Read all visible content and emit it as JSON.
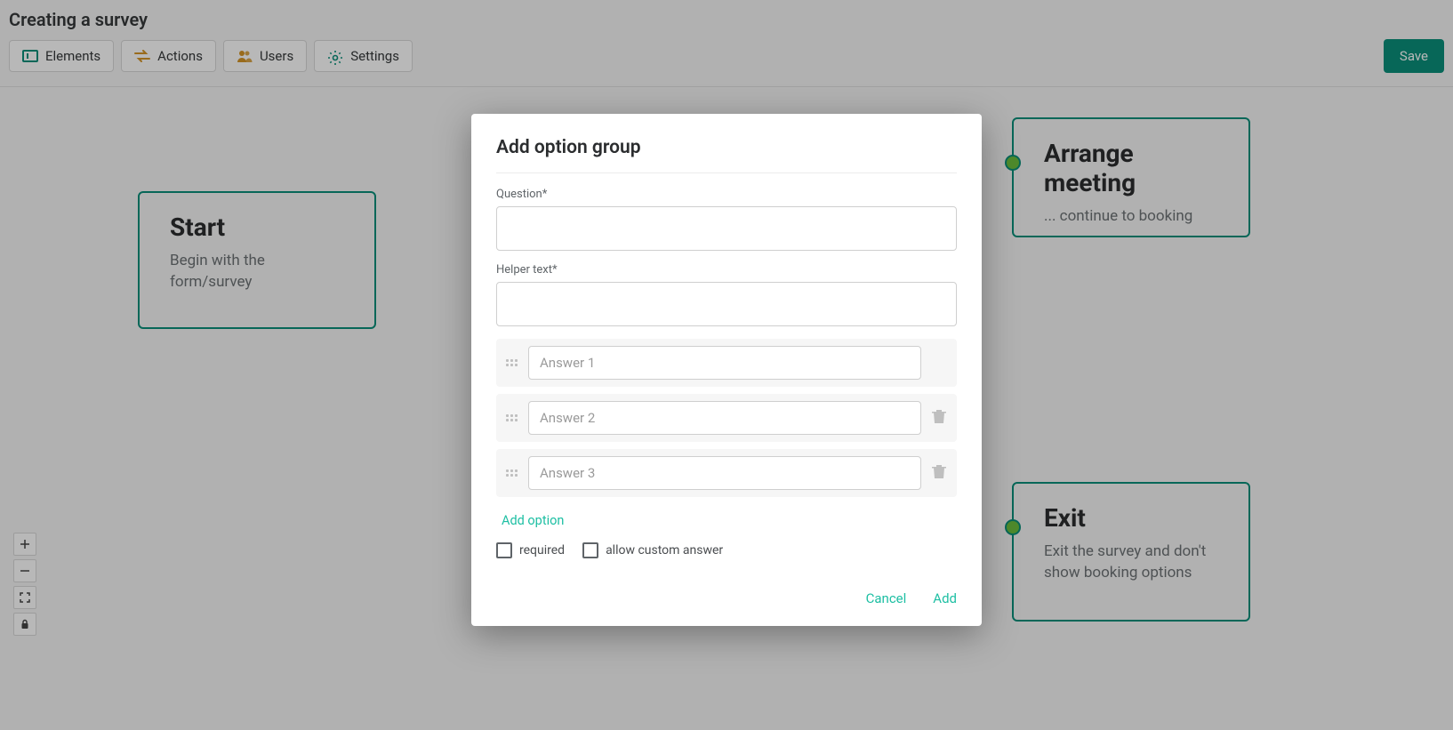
{
  "page_title": "Creating a survey",
  "toolbar": {
    "elements": "Elements",
    "actions": "Actions",
    "users": "Users",
    "settings": "Settings",
    "save": "Save"
  },
  "nodes": {
    "start": {
      "title": "Start",
      "desc": "Begin with the form/survey"
    },
    "arrange": {
      "title": "Arrange meeting",
      "desc": "... continue to booking"
    },
    "exit": {
      "title": "Exit",
      "desc": "Exit the survey and don't show booking options"
    }
  },
  "modal": {
    "title": "Add option group",
    "question_label": "Question*",
    "helper_label": "Helper text*",
    "answers": [
      {
        "placeholder": "Answer 1",
        "deletable": false
      },
      {
        "placeholder": "Answer 2",
        "deletable": true
      },
      {
        "placeholder": "Answer 3",
        "deletable": true
      }
    ],
    "add_option": "Add option",
    "required_label": "required",
    "custom_label": "allow custom answer",
    "cancel": "Cancel",
    "add": "Add"
  }
}
